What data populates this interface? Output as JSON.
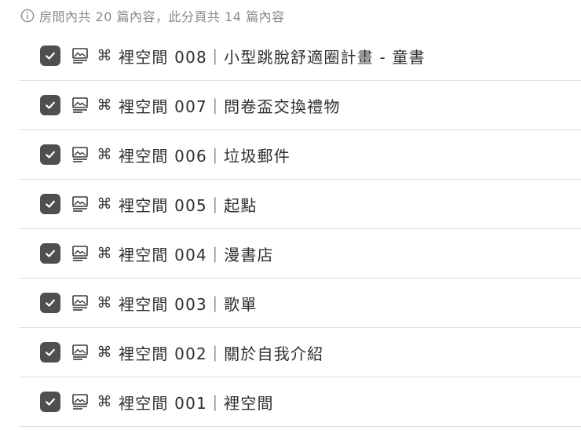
{
  "info": {
    "text": "房間內共 20 篇內容，此分頁共 14 篇內容",
    "icon": "info-circle-icon"
  },
  "items": [
    {
      "title": "裡空間 008｜小型跳脫舒適圈計畫 - 童書",
      "checked": true,
      "type_icon": "document-image-icon",
      "prefix_icon": "command-icon"
    },
    {
      "title": "裡空間 007｜問卷盃交換禮物",
      "checked": true,
      "type_icon": "document-image-icon",
      "prefix_icon": "command-icon"
    },
    {
      "title": "裡空間 006｜垃圾郵件",
      "checked": true,
      "type_icon": "document-image-icon",
      "prefix_icon": "command-icon"
    },
    {
      "title": "裡空間 005｜起點",
      "checked": true,
      "type_icon": "document-image-icon",
      "prefix_icon": "command-icon"
    },
    {
      "title": "裡空間 004｜漫書店",
      "checked": true,
      "type_icon": "document-image-icon",
      "prefix_icon": "command-icon"
    },
    {
      "title": "裡空間 003｜歌單",
      "checked": true,
      "type_icon": "document-image-icon",
      "prefix_icon": "command-icon"
    },
    {
      "title": "裡空間 002｜關於自我介紹",
      "checked": true,
      "type_icon": "document-image-icon",
      "prefix_icon": "command-icon"
    },
    {
      "title": "裡空間 001｜裡空間",
      "checked": true,
      "type_icon": "document-image-icon",
      "prefix_icon": "command-icon"
    }
  ],
  "colors": {
    "checkbox_fill": "#4f4f4f",
    "muted_text": "#8a8a8a",
    "divider": "#dedede"
  }
}
